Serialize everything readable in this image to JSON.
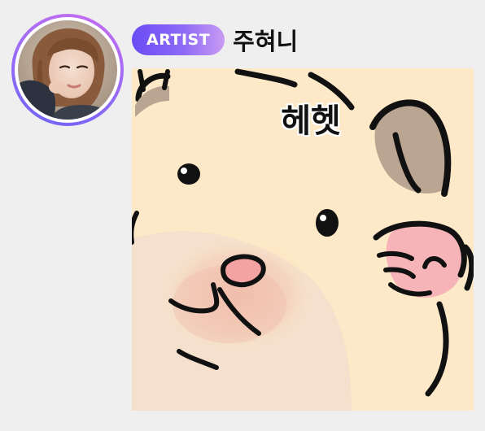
{
  "message": {
    "sender": {
      "role_badge": "ARTIST",
      "name": "주혀니"
    },
    "sticker": {
      "caption": "헤헷",
      "character": "hamster"
    }
  },
  "colors": {
    "background": "#efeff0",
    "badge_gradient_start": "#6a4cf5",
    "badge_gradient_end": "#c99af3",
    "avatar_ring": "#9b6cf6",
    "sticker_fur": "#fde9c7",
    "sticker_blush": "#f2b8a8",
    "sticker_nose": "#f4a3a3"
  }
}
